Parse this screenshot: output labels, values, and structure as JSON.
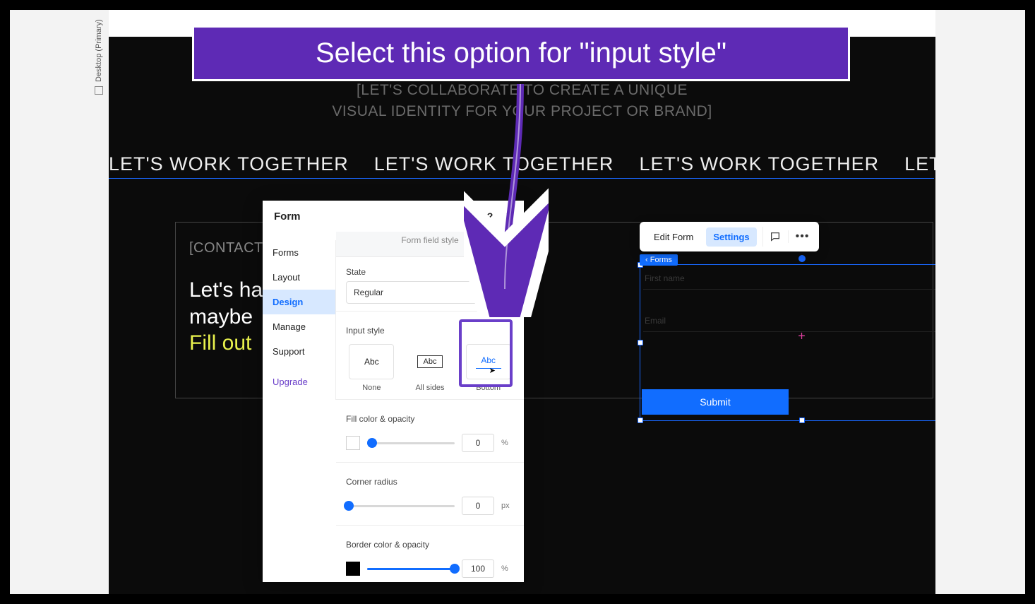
{
  "callout": {
    "text": "Select this option for \"input style\""
  },
  "rail": {
    "label": "Desktop (Primary)"
  },
  "hero": {
    "line1": "[LET'S COLLABORATE TO CREATE A UNIQUE",
    "line2": "VISUAL IDENTITY FOR YOUR PROJECT OR BRAND]"
  },
  "marquee_text": "LET'S WORK TOGETHER",
  "contact": {
    "label": "[CONTACT",
    "head1": "Let's ha",
    "head2": "maybe",
    "head3": "Fill out"
  },
  "panel": {
    "title": "Form",
    "tab_header": "Form field style",
    "nav": {
      "items": [
        "Forms",
        "Layout",
        "Design",
        "Manage",
        "Support"
      ],
      "active_index": 2,
      "upgrade": "Upgrade"
    },
    "state": {
      "label": "State",
      "value": "Regular"
    },
    "input_style": {
      "label": "Input style",
      "options": [
        {
          "abc": "Abc",
          "caption": "None"
        },
        {
          "abc": "Abc",
          "caption": "All sides"
        },
        {
          "abc": "Abc",
          "caption": "Bottom"
        }
      ]
    },
    "fill": {
      "label": "Fill color & opacity",
      "value": "0",
      "unit": "%",
      "pct": 6
    },
    "corner": {
      "label": "Corner radius",
      "value": "0",
      "unit": "px",
      "pct": 0
    },
    "border": {
      "label": "Border color & opacity",
      "value": "100",
      "unit": "%",
      "pct": 100
    }
  },
  "toolbar": {
    "edit": "Edit Form",
    "settings": "Settings"
  },
  "selected": {
    "tag": "Forms",
    "field1": "First name",
    "field2": "Email",
    "submit": "Submit"
  }
}
